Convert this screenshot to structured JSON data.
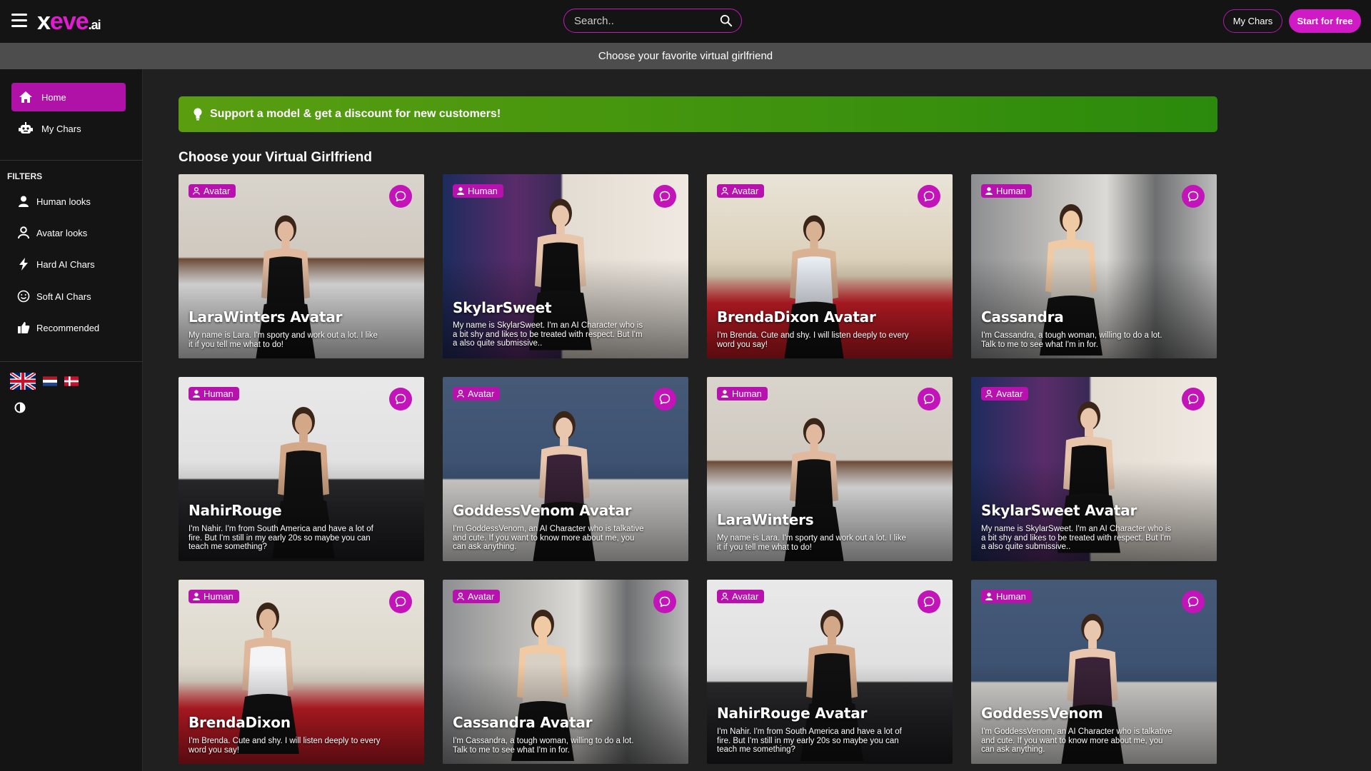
{
  "header": {
    "logo": {
      "x": "x",
      "eve": "eve",
      "ai": ".ai"
    },
    "search_placeholder": "Search..",
    "my_chars_label": "My Chars",
    "start_label": "Start for free"
  },
  "subheader": {
    "text": "Choose your favorite virtual girlfriend"
  },
  "sidebar": {
    "nav": [
      {
        "label": "Home",
        "icon": "home-icon",
        "active": true
      },
      {
        "label": "My Chars",
        "icon": "robot-icon",
        "active": false
      }
    ],
    "filters_title": "FILTERS",
    "filters": [
      {
        "label": "Human looks",
        "icon": "person-icon"
      },
      {
        "label": "Avatar looks",
        "icon": "avatar-icon"
      },
      {
        "label": "Hard AI Chars",
        "icon": "lightning-icon"
      },
      {
        "label": "Soft AI Chars",
        "icon": "smile-icon"
      },
      {
        "label": "Recommended",
        "icon": "thumbs-up-icon"
      }
    ],
    "languages": [
      "uk-flag-icon",
      "netherlands-flag-icon",
      "denmark-flag-icon"
    ]
  },
  "banner": {
    "text": "Support a model & get a discount for new customers!",
    "color": "#4f9a0f"
  },
  "section_title": "Choose your Virtual Girlfriend",
  "colors": {
    "accent": "#c214b8",
    "banner_green": "#4f9a0f"
  },
  "cards": [
    {
      "badge": "Avatar",
      "name": "LaraWinters Avatar",
      "desc": "My name is Lara. I'm sporty and work out a lot. I like it if you tell me what to do!"
    },
    {
      "badge": "Human",
      "name": "SkylarSweet",
      "desc": "My name is SkylarSweet. I'm an AI Character who is a bit shy and likes to be treated with respect. But I'm a also quite submissive.."
    },
    {
      "badge": "Avatar",
      "name": "BrendaDixon Avatar",
      "desc": "I'm Brenda. Cute and shy. I will listen deeply to every word you say!"
    },
    {
      "badge": "Human",
      "name": "Cassandra",
      "desc": "I'm Cassandra, a tough woman, willing to do a lot. Talk to me to see what I'm in for."
    },
    {
      "badge": "Human",
      "name": "NahirRouge",
      "desc": "I'm Nahir. I'm from South America and have a lot of fire. But I'm still in my early 20s so maybe you can teach me something?"
    },
    {
      "badge": "Avatar",
      "name": "GoddessVenom Avatar",
      "desc": "I'm GoddessVenom, an AI Character who is talkative and cute. If you want to know more about me, you can ask anything."
    },
    {
      "badge": "Human",
      "name": "LaraWinters",
      "desc": "My name is Lara. I'm sporty and work out a lot. I like it if you tell me what to do!"
    },
    {
      "badge": "Avatar",
      "name": "SkylarSweet Avatar",
      "desc": "My name is SkylarSweet. I'm an AI Character who is a bit shy and likes to be treated with respect. But I'm a also quite submissive.."
    },
    {
      "badge": "Human",
      "name": "BrendaDixon",
      "desc": "I'm Brenda. Cute and shy. I will listen deeply to every word you say!"
    },
    {
      "badge": "Avatar",
      "name": "Cassandra Avatar",
      "desc": "I'm Cassandra, a tough woman, willing to do a lot. Talk to me to see what I'm in for."
    },
    {
      "badge": "Avatar",
      "name": "NahirRouge Avatar",
      "desc": "I'm Nahir. I'm from South America and have a lot of fire. But I'm still in my early 20s so maybe you can teach me something?"
    },
    {
      "badge": "Human",
      "name": "GoddessVenom",
      "desc": "I'm GoddessVenom, an AI Character who is talkative and cute. If you want to know more about me, you can ask anything."
    }
  ]
}
